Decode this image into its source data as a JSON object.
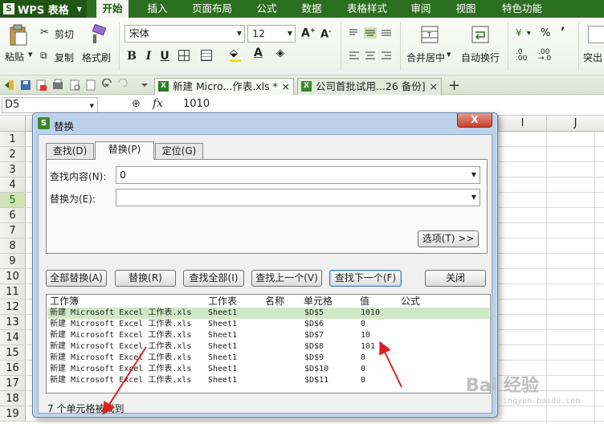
{
  "app": {
    "name": "WPS 表格",
    "logo_letter": "S"
  },
  "menu": [
    "开始",
    "插入",
    "页面布局",
    "公式",
    "数据",
    "表格样式",
    "审阅",
    "视图",
    "特色功能"
  ],
  "ribbon": {
    "paste": "粘贴",
    "cut": "剪切",
    "copy": "复制",
    "format_painter": "格式刷",
    "font_name": "宋体",
    "font_size": "12",
    "bold": "B",
    "italic": "I",
    "underline": "U",
    "merge_center": "合并居中",
    "wrap_text": "自动换行",
    "percent": "%",
    "insert_partial": "突出"
  },
  "doc_tabs": [
    {
      "label": "新建 Micro...作表.xls *",
      "close": "×"
    },
    {
      "label": "公司首批试用...26 备份]",
      "close": "×"
    }
  ],
  "formula_bar": {
    "cell_ref": "D5",
    "fx": "fx",
    "value": "1010"
  },
  "columns": [
    "I",
    "J"
  ],
  "rows": [
    "1",
    "2",
    "3",
    "4",
    "5",
    "6",
    "7",
    "8",
    "9",
    "10",
    "11",
    "12",
    "13",
    "14",
    "15",
    "16",
    "17",
    "18",
    "19"
  ],
  "dialog": {
    "title": "替换",
    "close": "X",
    "tabs": [
      "查找(D)",
      "替换(P)",
      "定位(G)"
    ],
    "find_label": "查找内容(N):",
    "find_value": "0",
    "replace_label": "替换为(E):",
    "replace_value": "",
    "options_btn": "选项(T) >>",
    "buttons": [
      "全部替换(A)",
      "替换(R)",
      "查找全部(I)",
      "查找上一个(V)",
      "查找下一个(F)",
      "关闭"
    ],
    "result_headers": [
      "工作簿",
      "工作表",
      "名称",
      "单元格",
      "值",
      "公式"
    ],
    "results": [
      {
        "book": "新建 Microsoft Excel 工作表.xls",
        "sheet": "Sheet1",
        "cell": "$D$5",
        "value": "1010"
      },
      {
        "book": "新建 Microsoft Excel 工作表.xls",
        "sheet": "Sheet1",
        "cell": "$D$6",
        "value": "0"
      },
      {
        "book": "新建 Microsoft Excel 工作表.xls",
        "sheet": "Sheet1",
        "cell": "$D$7",
        "value": "10"
      },
      {
        "book": "新建 Microsoft Excel 工作表.xls",
        "sheet": "Sheet1",
        "cell": "$D$8",
        "value": "101"
      },
      {
        "book": "新建 Microsoft Excel 工作表.xls",
        "sheet": "Sheet1",
        "cell": "$D$9",
        "value": "0"
      },
      {
        "book": "新建 Microsoft Excel 工作表.xls",
        "sheet": "Sheet1",
        "cell": "$D$10",
        "value": "0"
      },
      {
        "book": "新建 Microsoft Excel 工作表.xls",
        "sheet": "Sheet1",
        "cell": "$D$11",
        "value": "0"
      }
    ],
    "status": "7 个单元格被找到"
  },
  "watermark": {
    "text": "Bai 经验",
    "url": "jingyan.baidu.com"
  },
  "colors": {
    "menu_green": "#2c6e1f",
    "accent_red": "#e02020",
    "selection": "#cfe8c6"
  }
}
